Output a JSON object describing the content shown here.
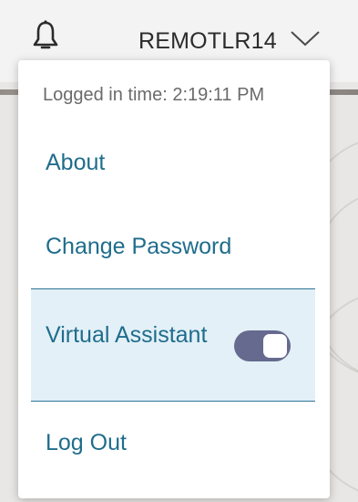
{
  "header": {
    "username": "REMOTLR14",
    "notifications_icon": "bell-icon",
    "menu_icon": "chevron-down-icon"
  },
  "menu": {
    "logged_in_time": "Logged in time: 2:19:11 PM",
    "items": [
      {
        "label": "About"
      },
      {
        "label": "Change Password"
      },
      {
        "label": "Virtual Assistant",
        "toggle_on": true
      },
      {
        "label": "Log Out"
      }
    ]
  },
  "colors": {
    "link": "#1f6d8c",
    "highlight": "#e3f0f7",
    "toggle": "#666a8e"
  }
}
